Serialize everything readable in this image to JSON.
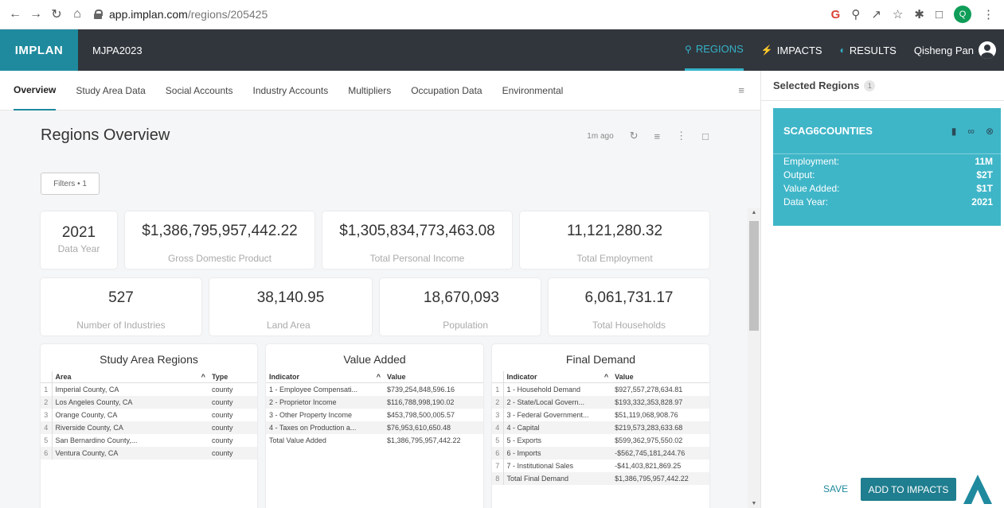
{
  "browser": {
    "url_host": "app.implan.com",
    "url_path": "/regions/205425"
  },
  "app": {
    "logo": "IMPLAN",
    "project": "MJPA2023",
    "nav": [
      {
        "label": "REGIONS",
        "icon": "map-pin-icon"
      },
      {
        "label": "IMPACTS",
        "icon": "bolt-icon"
      },
      {
        "label": "RESULTS",
        "icon": "pie-icon"
      }
    ],
    "user": "Qisheng Pan"
  },
  "tabs": [
    "Overview",
    "Study Area Data",
    "Social Accounts",
    "Industry Accounts",
    "Multipliers",
    "Occupation Data",
    "Environmental"
  ],
  "overview": {
    "title": "Regions Overview",
    "updated": "1m ago",
    "filters": "Filters • 1"
  },
  "stats_row1": [
    {
      "value": "2021",
      "label": "Data Year"
    },
    {
      "value": "$1,386,795,957,442.22",
      "label": "Gross Domestic Product"
    },
    {
      "value": "$1,305,834,773,463.08",
      "label": "Total Personal Income"
    },
    {
      "value": "11,121,280.32",
      "label": "Total Employment"
    }
  ],
  "stats_row2": [
    {
      "value": "527",
      "label": "Number of Industries"
    },
    {
      "value": "38,140.95",
      "label": "Land Area"
    },
    {
      "value": "18,670,093",
      "label": "Population"
    },
    {
      "value": "6,061,731.17",
      "label": "Total Households"
    }
  ],
  "study_area": {
    "title": "Study Area Regions",
    "columns": [
      "Area",
      "Type"
    ],
    "rows": [
      [
        "1",
        "Imperial County, CA",
        "county"
      ],
      [
        "2",
        "Los Angeles County, CA",
        "county"
      ],
      [
        "3",
        "Orange County, CA",
        "county"
      ],
      [
        "4",
        "Riverside County, CA",
        "county"
      ],
      [
        "5",
        "San Bernardino County,...",
        "county"
      ],
      [
        "6",
        "Ventura County, CA",
        "county"
      ]
    ]
  },
  "value_added": {
    "title": "Value Added",
    "columns": [
      "Indicator",
      "Value"
    ],
    "rows": [
      [
        "1 - Employee Compensati...",
        "$739,254,848,596.16"
      ],
      [
        "2 - Proprietor Income",
        "$116,788,998,190.02"
      ],
      [
        "3 - Other Property Income",
        "$453,798,500,005.57"
      ],
      [
        "4 - Taxes on Production a...",
        "$76,953,610,650.48"
      ],
      [
        "Total Value Added",
        "$1,386,795,957,442.22"
      ]
    ]
  },
  "final_demand": {
    "title": "Final Demand",
    "columns": [
      "Indicator",
      "Value"
    ],
    "rows": [
      [
        "1",
        "1 - Household Demand",
        "$927,557,278,634.81"
      ],
      [
        "2",
        "2 - State/Local Govern...",
        "$193,332,353,828.97"
      ],
      [
        "3",
        "3 - Federal Government...",
        "$51,119,068,908.76"
      ],
      [
        "4",
        "4 - Capital",
        "$219,573,283,633.68"
      ],
      [
        "5",
        "5 - Exports",
        "$599,362,975,550.02"
      ],
      [
        "6",
        "6 - Imports",
        "-$562,745,181,244.76"
      ],
      [
        "7",
        "7 - Institutional Sales",
        "-$41,403,821,869.25"
      ],
      [
        "8",
        "Total Final Demand",
        "$1,386,795,957,442.22"
      ]
    ]
  },
  "sidebar": {
    "title": "Selected Regions",
    "count": "1",
    "region": {
      "name": "SCAG6COUNTIES",
      "rows": [
        {
          "label": "Employment:",
          "value": "11M"
        },
        {
          "label": "Output:",
          "value": "$2T"
        },
        {
          "label": "Value Added:",
          "value": "$1T"
        },
        {
          "label": "Data Year:",
          "value": "2021"
        }
      ]
    },
    "save": "SAVE",
    "add": "ADD TO IMPACTS"
  },
  "colors": {
    "accent": "#1f8a9e",
    "card": "#3fb6c8",
    "header": "#31363d"
  }
}
